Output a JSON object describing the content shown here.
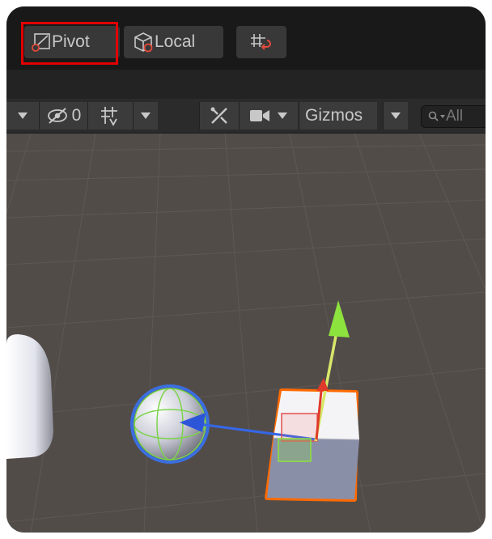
{
  "toolbar": {
    "pivot_label": "Pivot",
    "local_label": "Local"
  },
  "scene_toolbar": {
    "hidden_count": "0",
    "gizmos_label": "Gizmos",
    "search_placeholder": "All"
  },
  "colors": {
    "highlight": "#e20000",
    "selection_outline": "#ff6a00",
    "y_axis": "#8de33d",
    "z_axis": "#3567e6",
    "x_axis": "#e03a2a"
  }
}
